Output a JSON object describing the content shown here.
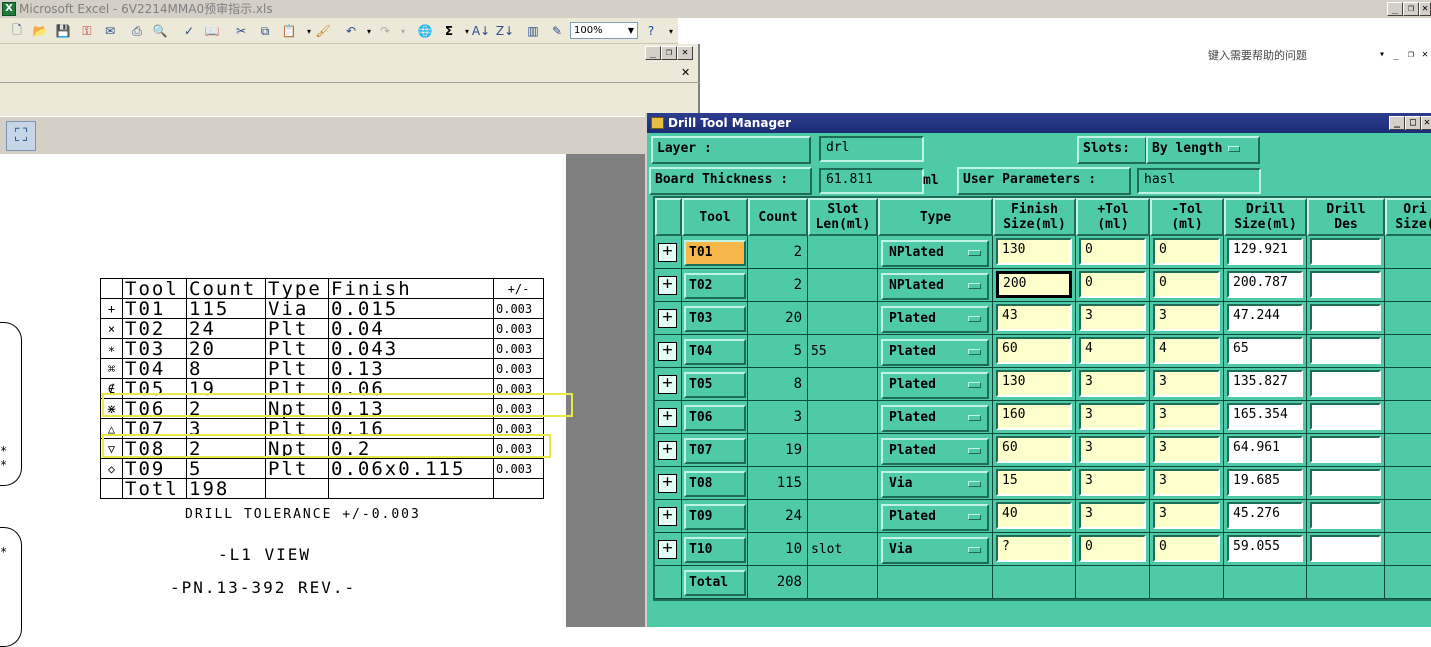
{
  "excel": {
    "title": "Microsoft Excel - 6V2214MMA0预审指示.xls",
    "zoom": "100%",
    "help_placeholder": "键入需要帮助的问题"
  },
  "drawing": {
    "header": {
      "tool": "Tool",
      "count": "Count",
      "type": "Type",
      "finish": "Finish",
      "tol": "+/-"
    },
    "rows": [
      {
        "sym": "+",
        "tool": "T01",
        "count": "115",
        "type": "Via",
        "finish": "0.015",
        "tol": "0.003"
      },
      {
        "sym": "×",
        "tool": "T02",
        "count": "24",
        "type": "Plt",
        "finish": "0.04",
        "tol": "0.003"
      },
      {
        "sym": "∗",
        "tool": "T03",
        "count": "20",
        "type": "Plt",
        "finish": "0.043",
        "tol": "0.003"
      },
      {
        "sym": "⌘",
        "tool": "T04",
        "count": "8",
        "type": "Plt",
        "finish": "0.13",
        "tol": "0.003"
      },
      {
        "sym": "∉",
        "tool": "T05",
        "count": "19",
        "type": "Plt",
        "finish": "0.06",
        "tol": "0.003"
      },
      {
        "sym": "⋇",
        "tool": "T06",
        "count": "2",
        "type": "Npt",
        "finish": "0.13",
        "tol": "0.003"
      },
      {
        "sym": "△",
        "tool": "T07",
        "count": "3",
        "type": "Plt",
        "finish": "0.16",
        "tol": "0.003"
      },
      {
        "sym": "▽",
        "tool": "T08",
        "count": "2",
        "type": "Npt",
        "finish": "0.2",
        "tol": "0.003"
      },
      {
        "sym": "◇",
        "tool": "T09",
        "count": "5",
        "type": "Plt",
        "finish": "0.06x0.115",
        "tol": "0.003"
      }
    ],
    "total_label": "Totl",
    "total_count": "198",
    "tolerance_note": "DRILL TOLERANCE +/-0.003",
    "view_label": "-L1 VIEW",
    "pn_label": "-PN.13-392 REV.-"
  },
  "dtm": {
    "title": "Drill Tool Manager",
    "layer_label": "Layer         :",
    "layer_value": "drl",
    "slots_label": "Slots:",
    "slots_value": "By length",
    "board_thickness_label": "Board Thickness :",
    "board_thickness_value": "61.811",
    "board_thickness_unit": "ml",
    "user_params_label": "User Parameters :",
    "user_params_value": "hasl",
    "headers": {
      "tool": "Tool",
      "count": "Count",
      "slot_len": "Slot\nLen(ml)",
      "type": "Type",
      "finish": "Finish\nSize(ml)",
      "ptol": "+Tol\n(ml)",
      "mtol": "-Tol\n(ml)",
      "drill_size": "Drill\nSize(ml)",
      "drill_des": "Drill\nDes",
      "orig_size": "Ori\nSize("
    },
    "rows": [
      {
        "tool": "T01",
        "count": "2",
        "slot": "",
        "type": "NPlated",
        "finish": "130",
        "ptol": "0",
        "mtol": "0",
        "drill": "129.921"
      },
      {
        "tool": "T02",
        "count": "2",
        "slot": "",
        "type": "NPlated",
        "finish": "200",
        "ptol": "0",
        "mtol": "0",
        "drill": "200.787"
      },
      {
        "tool": "T03",
        "count": "20",
        "slot": "",
        "type": "Plated",
        "finish": "43",
        "ptol": "3",
        "mtol": "3",
        "drill": "47.244"
      },
      {
        "tool": "T04",
        "count": "5",
        "slot": "55",
        "type": "Plated",
        "finish": "60",
        "ptol": "4",
        "mtol": "4",
        "drill": "65"
      },
      {
        "tool": "T05",
        "count": "8",
        "slot": "",
        "type": "Plated",
        "finish": "130",
        "ptol": "3",
        "mtol": "3",
        "drill": "135.827"
      },
      {
        "tool": "T06",
        "count": "3",
        "slot": "",
        "type": "Plated",
        "finish": "160",
        "ptol": "3",
        "mtol": "3",
        "drill": "165.354"
      },
      {
        "tool": "T07",
        "count": "19",
        "slot": "",
        "type": "Plated",
        "finish": "60",
        "ptol": "3",
        "mtol": "3",
        "drill": "64.961"
      },
      {
        "tool": "T08",
        "count": "115",
        "slot": "",
        "type": "Via",
        "finish": "15",
        "ptol": "3",
        "mtol": "3",
        "drill": "19.685"
      },
      {
        "tool": "T09",
        "count": "24",
        "slot": "",
        "type": "Plated",
        "finish": "40",
        "ptol": "3",
        "mtol": "3",
        "drill": "45.276"
      },
      {
        "tool": "T10",
        "count": "10",
        "slot": "slot",
        "type": "Via",
        "finish": "?",
        "ptol": "0",
        "mtol": "0",
        "drill": "59.055"
      }
    ],
    "total_label": "Total",
    "total_count": "208"
  }
}
